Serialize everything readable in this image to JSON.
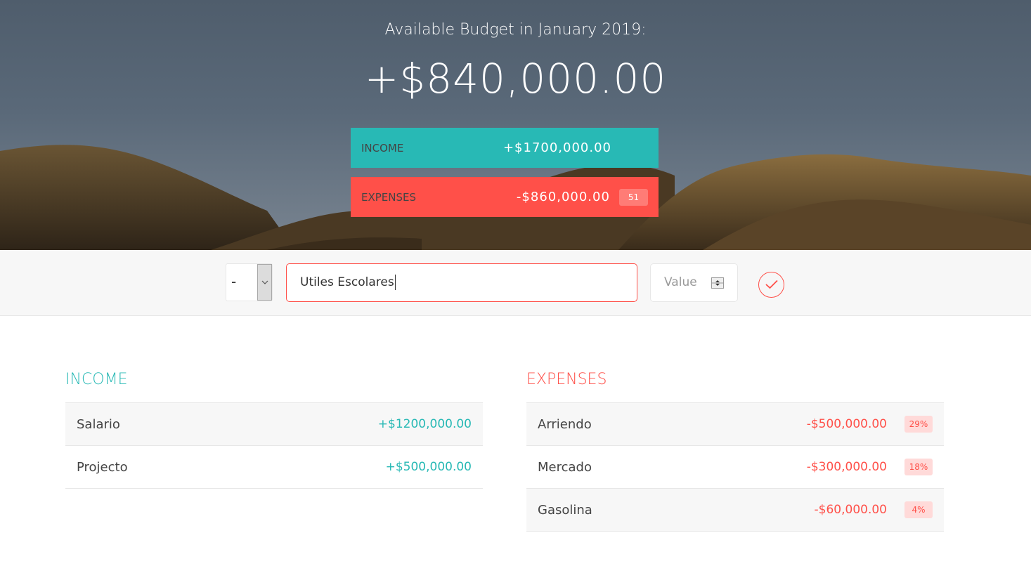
{
  "budget": {
    "title": "Available Budget in January 2019:",
    "value": "+$840,000.00"
  },
  "summary": {
    "income_label": "Income",
    "income_value": "+$1700,000.00",
    "expenses_label": "Expenses",
    "expenses_value": "-$860,000.00",
    "expenses_percentage": "51"
  },
  "add": {
    "type_value": "-",
    "description_value": "Utiles Escolares",
    "value_placeholder": "Value"
  },
  "income": {
    "title": "Income",
    "items": [
      {
        "description": "Salario",
        "value": "+$1200,000.00"
      },
      {
        "description": "Projecto",
        "value": "+$500,000.00"
      }
    ]
  },
  "expenses": {
    "title": "Expenses",
    "items": [
      {
        "description": "Arriendo",
        "value": "-$500,000.00",
        "percentage": "29%"
      },
      {
        "description": "Mercado",
        "value": "-$300,000.00",
        "percentage": "18%"
      },
      {
        "description": "Gasolina",
        "value": "-$60,000.00",
        "percentage": "4%"
      }
    ]
  },
  "colors": {
    "income": "#28b9b5",
    "expenses": "#ff5049"
  }
}
